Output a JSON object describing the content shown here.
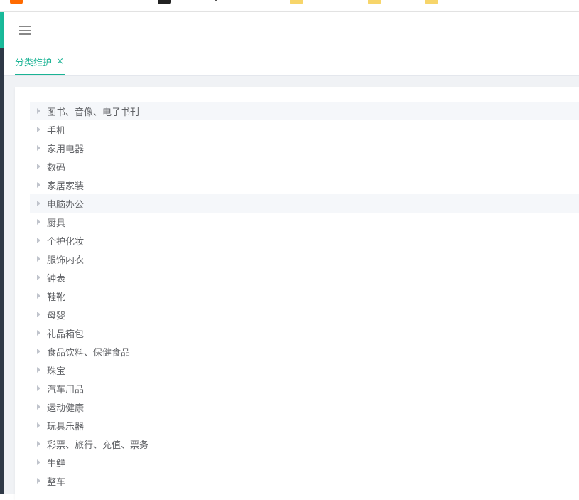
{
  "tabs": [
    {
      "label": "分类维护",
      "close": "×"
    }
  ],
  "tree": {
    "nodes": [
      {
        "label": "图书、音像、电子书刊"
      },
      {
        "label": "手机"
      },
      {
        "label": "家用电器"
      },
      {
        "label": "数码"
      },
      {
        "label": "家居家装"
      },
      {
        "label": "电脑办公"
      },
      {
        "label": "厨具"
      },
      {
        "label": "个护化妆"
      },
      {
        "label": "服饰内衣"
      },
      {
        "label": "钟表"
      },
      {
        "label": "鞋靴"
      },
      {
        "label": "母婴"
      },
      {
        "label": "礼品箱包"
      },
      {
        "label": "食品饮料、保健食品"
      },
      {
        "label": "珠宝"
      },
      {
        "label": "汽车用品"
      },
      {
        "label": "运动健康"
      },
      {
        "label": "玩具乐器"
      },
      {
        "label": "彩票、旅行、充值、票务"
      },
      {
        "label": "生鲜"
      },
      {
        "label": "整车"
      }
    ]
  },
  "colors": {
    "accent": "#1ab394",
    "sidebar": "#2f3947",
    "highlight_row": "#f5f7fa",
    "text": "#606266"
  },
  "icons": {
    "menu_toggle": "hamburger-icon",
    "expand": "caret-right-icon"
  }
}
